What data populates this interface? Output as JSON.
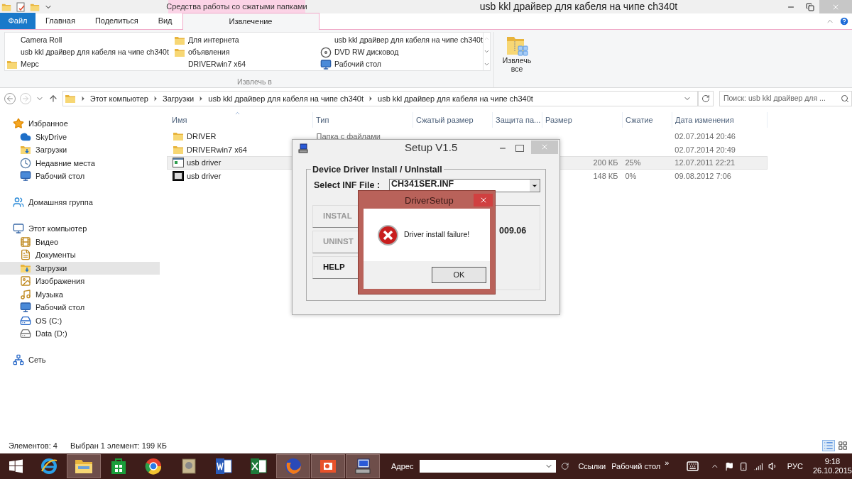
{
  "explorer": {
    "title": "usb kkl драйвер для кабеля на чипе ch340t",
    "context_group": "Средства работы со сжатыми папками",
    "ribbon_tabs": [
      {
        "label": "Файл",
        "kind": "file",
        "selected": false
      },
      {
        "label": "Главная",
        "kind": "normal",
        "selected": false
      },
      {
        "label": "Поделиться",
        "kind": "normal",
        "selected": false
      },
      {
        "label": "Вид",
        "kind": "normal",
        "selected": false
      },
      {
        "label": "Извлечение",
        "kind": "context",
        "selected": true
      }
    ],
    "extract_to": {
      "items": [
        {
          "label": "Camera Roll",
          "kind": "plain"
        },
        {
          "label": "Для интернета",
          "kind": "folder"
        },
        {
          "label": "usb kkl драйвер для кабеля на чипе ch340t",
          "kind": "plain"
        },
        {
          "label": "usb kkl драйвер для кабеля на чипе ch340t",
          "kind": "plain"
        },
        {
          "label": "объявления",
          "kind": "folder"
        },
        {
          "label": "DVD RW дисковод",
          "kind": "dvd"
        },
        {
          "label": "Мерс",
          "kind": "folder"
        },
        {
          "label": "DRIVERwin7 x64",
          "kind": "plain"
        },
        {
          "label": "Рабочий стол",
          "kind": "desktop"
        }
      ],
      "group_label": "Извлечь в"
    },
    "extract_all": "Извлечь все",
    "path": [
      "Этот компьютер",
      "Загрузки",
      "usb kkl драйвер для кабеля на чипе ch340t",
      "usb kkl драйвер для кабеля на чипе ch340t"
    ],
    "search": {
      "placeholder": "Поиск: usb kkl драйвер для ..."
    },
    "navigation": [
      {
        "label": "Избранное",
        "kind": "star",
        "selected": false,
        "children": [
          {
            "label": "SkyDrive",
            "kind": "cloud",
            "selected": false
          },
          {
            "label": "Загрузки",
            "kind": "download",
            "selected": false
          },
          {
            "label": "Недавние места",
            "kind": "recent",
            "selected": false
          },
          {
            "label": "Рабочий стол",
            "kind": "desktop",
            "selected": false
          }
        ]
      },
      {
        "label": "Домашняя группа",
        "kind": "homegroup",
        "selected": false
      },
      {
        "label": "Этот компьютер",
        "kind": "computer",
        "selected": false,
        "children": [
          {
            "label": "Видео",
            "kind": "video",
            "selected": false
          },
          {
            "label": "Документы",
            "kind": "documents",
            "selected": false
          },
          {
            "label": "Загрузки",
            "kind": "download",
            "selected": true
          },
          {
            "label": "Изображения",
            "kind": "images",
            "selected": false
          },
          {
            "label": "Музыка",
            "kind": "music",
            "selected": false
          },
          {
            "label": "Рабочий стол",
            "kind": "desktop",
            "selected": false
          },
          {
            "label": "OS (C:)",
            "kind": "system-disk",
            "selected": false
          },
          {
            "label": "Data (D:)",
            "kind": "disk",
            "selected": false
          }
        ]
      },
      {
        "label": "Сеть",
        "kind": "network",
        "selected": false
      }
    ],
    "columns": [
      "Имя",
      "Тип",
      "Сжатый размер",
      "Защита па...",
      "Размер",
      "Сжатие",
      "Дата изменения"
    ],
    "rows": [
      {
        "kind": "folder",
        "name": "DRIVER",
        "type": "Папка с файлами",
        "modified": "02.07.2014 20:46",
        "selected": false
      },
      {
        "kind": "folder",
        "name": "DRIVERwin7 x64",
        "modified": "02.07.2014 20:49",
        "selected": false
      },
      {
        "kind": "program",
        "name": "usb driver",
        "size": "200 КБ",
        "ratio": "25%",
        "modified": "12.07.2011 22:21",
        "selected": true
      },
      {
        "kind": "archive",
        "name": "usb driver",
        "size": "148 КБ",
        "ratio": "0%",
        "modified": "09.08.2012 7:06",
        "selected": false
      }
    ],
    "status": {
      "count": "Элементов: 4",
      "selection": "Выбран 1 элемент: 199 КБ"
    }
  },
  "setup_window": {
    "title": "Setup V1.5",
    "group_title": "Device Driver Install / UnInstall",
    "inf_label": "Select INF File :",
    "inf_value": "CH341SER.INF",
    "buttons": [
      {
        "label": "INSTAL",
        "disabled": true
      },
      {
        "label": "UNINST",
        "disabled": true
      },
      {
        "label": "HELP",
        "disabled": false
      }
    ],
    "info": "009.06"
  },
  "alert": {
    "title": "DriverSetup",
    "message": "Driver install failure!",
    "button": "OK"
  },
  "taskbar": {
    "apps": [
      {
        "kind": "ie",
        "active": false
      },
      {
        "kind": "explorer",
        "active": true
      },
      {
        "kind": "store",
        "active": false
      },
      {
        "kind": "chrome",
        "active": false
      },
      {
        "kind": "tool",
        "active": false
      },
      {
        "kind": "word",
        "active": false
      },
      {
        "kind": "excel",
        "active": false
      },
      {
        "kind": "firefox",
        "active": true
      },
      {
        "kind": "powerpoint",
        "active": true
      },
      {
        "kind": "setup",
        "active": true
      }
    ],
    "address_label": "Адрес",
    "links": "Ссылки",
    "desktop": "Рабочий стол",
    "chevron": "»",
    "language": "РУС",
    "time": "9:18",
    "date": "26.10.2015"
  }
}
